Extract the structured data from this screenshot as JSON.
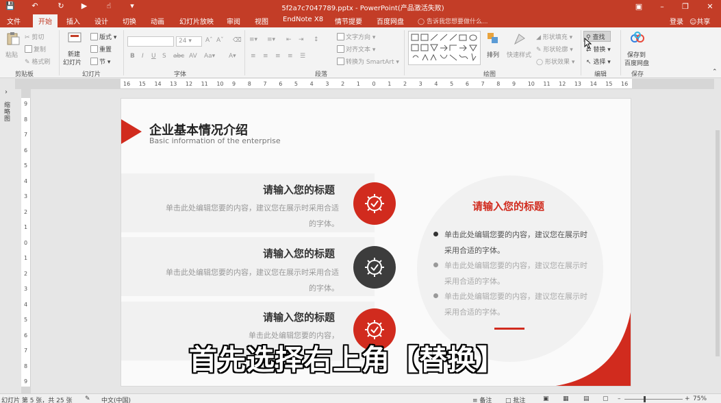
{
  "titlebar": {
    "filename": "5f2a7c7047789.pptx - PowerPoint(产品激活失败)"
  },
  "menu": {
    "tabs": [
      "文件",
      "开始",
      "插入",
      "设计",
      "切换",
      "动画",
      "幻灯片放映",
      "审阅",
      "视图",
      "EndNote X8",
      "情节提要",
      "百度网盘"
    ],
    "active_tab": "开始",
    "tell_me": "告诉我您想要做什么...",
    "login": "登录",
    "share": "共享"
  },
  "ribbon": {
    "clipboard": {
      "paste": "粘贴",
      "cut": "剪切",
      "copy": "复制",
      "format_painter": "格式刷",
      "label": "剪贴板"
    },
    "slides": {
      "new_slide_l1": "新建",
      "new_slide_l2": "幻灯片",
      "layout": "版式",
      "reset": "重置",
      "section": "节",
      "label": "幻灯片"
    },
    "font": {
      "size": "24",
      "label": "字体"
    },
    "paragraph": {
      "text_direction": "文字方向",
      "align_text": "对齐文本",
      "smartart": "转换为 SmartArt",
      "label": "段落"
    },
    "drawing": {
      "arrange": "排列",
      "quick_styles": "快速样式",
      "shape_fill": "形状填充",
      "shape_outline": "形状轮廓",
      "shape_effects": "形状效果",
      "label": "绘图"
    },
    "editing": {
      "find": "查找",
      "replace": "替换",
      "select": "选择",
      "label": "编辑"
    },
    "save": {
      "save_l1": "保存到",
      "save_l2": "百度网盘",
      "label": "保存"
    }
  },
  "leftpane": {
    "label": "缩略图"
  },
  "ruler": {
    "h_ticks": [
      "16",
      "15",
      "14",
      "13",
      "12",
      "11",
      "10",
      "9",
      "8",
      "7",
      "6",
      "5",
      "4",
      "3",
      "2",
      "1",
      "0",
      "1",
      "2",
      "3",
      "4",
      "5",
      "6",
      "7",
      "8",
      "9",
      "10",
      "11",
      "12",
      "13",
      "14",
      "15",
      "16"
    ],
    "v_ticks": [
      "9",
      "8",
      "7",
      "6",
      "5",
      "4",
      "3",
      "2",
      "1",
      "0",
      "1",
      "2",
      "3",
      "4",
      "5",
      "6",
      "7",
      "8",
      "9"
    ]
  },
  "slide": {
    "title": "企业基本情况介绍",
    "subtitle": "Basic information of the enterprise",
    "items": [
      {
        "heading": "请输入您的标题",
        "body": "单击此处编辑您要的内容，建议您在展示时采用合适的字体。"
      },
      {
        "heading": "请输入您的标题",
        "body": "单击此处编辑您要的内容，建议您在展示时采用合适的字体。"
      },
      {
        "heading": "请输入您的标题",
        "body": "单击此处编辑您要的内容，"
      }
    ],
    "right_heading": "请输入您的标题",
    "bullets": [
      "单击此处编辑您要的内容，建议您在展示时采用合适的字体。",
      "单击此处编辑您要的内容，建议您在展示时采用合适的字体。",
      "单击此处编辑您要的内容，建议您在展示时采用合适的字体。"
    ],
    "colors": {
      "accent": "#d12b1e",
      "dark": "#3c3c3c"
    }
  },
  "caption": "首先选择右上角【替换】",
  "status": {
    "slide_info": "幻灯片 第 5 张，共 25 张",
    "language": "中文(中国)",
    "notes": "备注",
    "comments": "批注",
    "zoom": "75%"
  }
}
